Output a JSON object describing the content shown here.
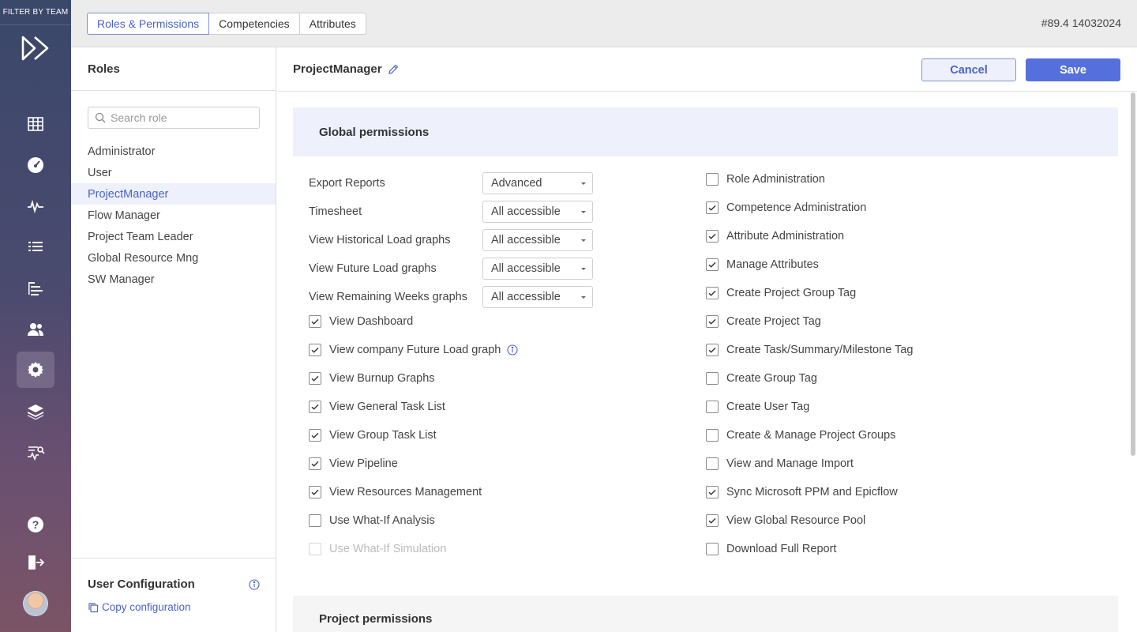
{
  "rail": {
    "filter_label": "FILTER BY TEAM"
  },
  "topbar": {
    "tabs": [
      {
        "label": "Roles & Permissions",
        "active": true
      },
      {
        "label": "Competencies",
        "active": false
      },
      {
        "label": "Attributes",
        "active": false
      }
    ],
    "version": "#89.4 14032024"
  },
  "roles_panel": {
    "title": "Roles",
    "search_placeholder": "Search role",
    "roles": [
      "Administrator",
      "User",
      "ProjectManager",
      "Flow Manager",
      "Project Team Leader",
      "Global Resource Mng",
      "SW Manager"
    ],
    "selected_role": "ProjectManager",
    "user_configuration": {
      "title": "User Configuration",
      "copy_label": "Copy configuration"
    }
  },
  "main": {
    "role_name": "ProjectManager",
    "cancel_label": "Cancel",
    "save_label": "Save",
    "global_title": "Global permissions",
    "project_title": "Project permissions",
    "dropdowns": [
      {
        "label": "Export Reports",
        "value": "Advanced"
      },
      {
        "label": "Timesheet",
        "value": "All accessible"
      },
      {
        "label": "View Historical Load graphs",
        "value": "All accessible"
      },
      {
        "label": "View Future Load graphs",
        "value": "All accessible"
      },
      {
        "label": "View Remaining Weeks graphs",
        "value": "All accessible"
      }
    ],
    "left_checks": [
      {
        "label": "View Dashboard",
        "checked": true
      },
      {
        "label": "View company Future Load graph",
        "checked": true,
        "info": true
      },
      {
        "label": "View Burnup Graphs",
        "checked": true
      },
      {
        "label": "View General Task List",
        "checked": true
      },
      {
        "label": "View Group Task List",
        "checked": true
      },
      {
        "label": "View Pipeline",
        "checked": true
      },
      {
        "label": "View Resources Management",
        "checked": true
      },
      {
        "label": "Use What-If Analysis",
        "checked": false
      },
      {
        "label": "Use What-If Simulation",
        "checked": false,
        "disabled": true
      }
    ],
    "right_checks": [
      {
        "label": "Role Administration",
        "checked": false
      },
      {
        "label": "Competence Administration",
        "checked": true
      },
      {
        "label": "Attribute Administration",
        "checked": true
      },
      {
        "label": "Manage Attributes",
        "checked": true
      },
      {
        "label": "Create Project Group Tag",
        "checked": true
      },
      {
        "label": "Create Project Tag",
        "checked": true
      },
      {
        "label": "Create Task/Summary/Milestone Tag",
        "checked": true
      },
      {
        "label": "Create Group Tag",
        "checked": false
      },
      {
        "label": "Create User Tag",
        "checked": false
      },
      {
        "label": "Create & Manage Project Groups",
        "checked": false
      },
      {
        "label": "View and Manage Import",
        "checked": false
      },
      {
        "label": "Sync Microsoft PPM and Epicflow",
        "checked": true
      },
      {
        "label": "View Global Resource Pool",
        "checked": true
      },
      {
        "label": "Download Full Report",
        "checked": false
      }
    ]
  },
  "colors": {
    "accent": "#5570dc",
    "active_tab_text": "#4a63c8",
    "selected_row_bg": "#eef1fb"
  }
}
